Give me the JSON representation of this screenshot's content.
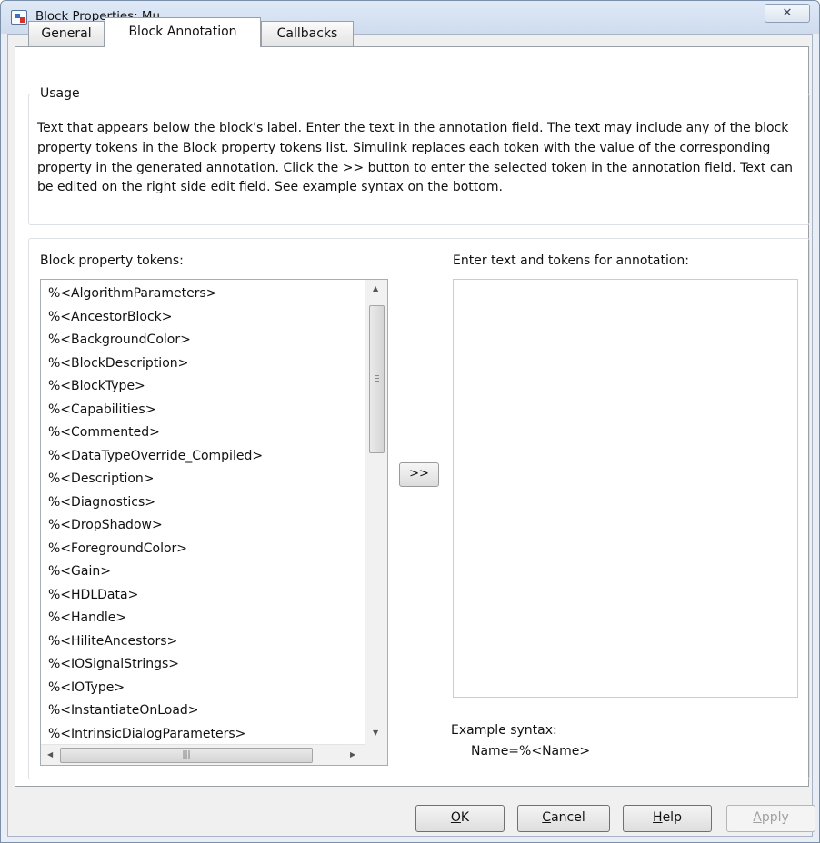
{
  "window": {
    "title": "Block Properties: Mu",
    "close_glyph": "✕"
  },
  "tabs": [
    {
      "label": "General"
    },
    {
      "label": "Block Annotation",
      "active": true
    },
    {
      "label": "Callbacks"
    }
  ],
  "usage": {
    "title": "Usage",
    "text": "Text that appears below the block's label. Enter the text in the annotation field. The text may include any of the block property tokens in the Block property tokens list. Simulink replaces each token with the value of the corresponding property in the generated annotation. Click the >> button to enter the selected token in the annotation field. Text can be edited on the right side edit field. See example syntax on the bottom."
  },
  "tokens": {
    "label": "Block property tokens:",
    "items": [
      "%<AlgorithmParameters>",
      "%<AncestorBlock>",
      "%<BackgroundColor>",
      "%<BlockDescription>",
      "%<BlockType>",
      "%<Capabilities>",
      "%<Commented>",
      "%<DataTypeOverride_Compiled>",
      "%<Description>",
      "%<Diagnostics>",
      "%<DropShadow>",
      "%<ForegroundColor>",
      "%<Gain>",
      "%<HDLData>",
      "%<Handle>",
      "%<HiliteAncestors>",
      "%<IOSignalStrings>",
      "%<IOType>",
      "%<InstantiateOnLoad>",
      "%<IntrinsicDialogParameters>"
    ]
  },
  "add_button_label": ">>",
  "annotation": {
    "label": "Enter text and tokens for annotation:",
    "value": "",
    "example_label": "Example syntax:",
    "example_value": "Name=%<Name>"
  },
  "buttons": {
    "ok": {
      "mnemonic": "O",
      "rest": "K"
    },
    "cancel": {
      "mnemonic": "C",
      "rest": "ancel"
    },
    "help": {
      "mnemonic": "H",
      "rest": "elp"
    },
    "apply": {
      "mnemonic": "A",
      "rest": "pply",
      "enabled": false
    }
  },
  "colors": {
    "titlebar": "#dfe9f7",
    "dialog_bg": "#f0f0f0",
    "panel_bg": "#ffffff"
  }
}
